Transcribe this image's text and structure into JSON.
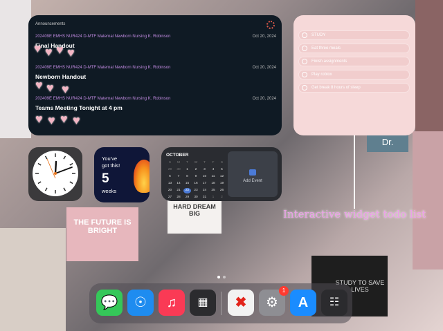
{
  "announcements": {
    "header": "Announcements",
    "items": [
      {
        "course": "202409E EMHS NUR424 D-MTF Maternal Newborn Nursing K. Robinson",
        "date": "Oct 20, 2024",
        "title": "Final Handout"
      },
      {
        "course": "202409E EMHS NUR424 D-MTF Maternal Newborn Nursing K. Robinson",
        "date": "Oct 20, 2024",
        "title": "Newborn Handout"
      },
      {
        "course": "202409E EMHS NUR424 D-MTF Maternal Newborn Nursing K. Robinson",
        "date": "Oct 20, 2024",
        "title": "Teams Meeting Tonight at 4 pm"
      }
    ]
  },
  "todo": {
    "items": [
      "STUDY",
      "Eat three meals",
      "Finish assignments",
      "Play roblox",
      "Get break 8 hours of sleep"
    ]
  },
  "countdown": {
    "line1": "You've",
    "line2": "got this!",
    "value": "5",
    "unit": "weeks"
  },
  "calendar": {
    "month": "OCTOBER",
    "weekdays": [
      "S",
      "M",
      "T",
      "W",
      "T",
      "F",
      "S"
    ],
    "rows": [
      [
        "29",
        "30",
        "1",
        "2",
        "3",
        "4",
        "5"
      ],
      [
        "6",
        "7",
        "8",
        "9",
        "10",
        "11",
        "12"
      ],
      [
        "13",
        "14",
        "15",
        "16",
        "17",
        "18",
        "19"
      ],
      [
        "20",
        "21",
        "22",
        "23",
        "24",
        "25",
        "26"
      ],
      [
        "27",
        "28",
        "29",
        "30",
        "31",
        "1",
        "2"
      ]
    ],
    "today": "22",
    "add_event": "Add Event"
  },
  "wallpaper": {
    "caption": "Interactive widget todo list",
    "sign1": "HARD DREAM BIG",
    "sign2": "THE FUTURE IS BRIGHT",
    "sign3": "STUDY TO SAVE LIVES",
    "sign4": "Dr."
  },
  "dock": {
    "apps": [
      {
        "name": "Messages",
        "color": "#35c759"
      },
      {
        "name": "Safari",
        "color": "#1e8cf0"
      },
      {
        "name": "Music",
        "color": "#fa3a55"
      },
      {
        "name": "App Library",
        "color": "#2b2b2e"
      },
      {
        "name": "Close",
        "color": "#f2f2f2"
      },
      {
        "name": "Settings",
        "color": "#8e8e93",
        "badge": "1"
      },
      {
        "name": "App Store",
        "color": "#1a8cff"
      },
      {
        "name": "Shortcuts",
        "color": "#2b2b2e"
      }
    ]
  }
}
